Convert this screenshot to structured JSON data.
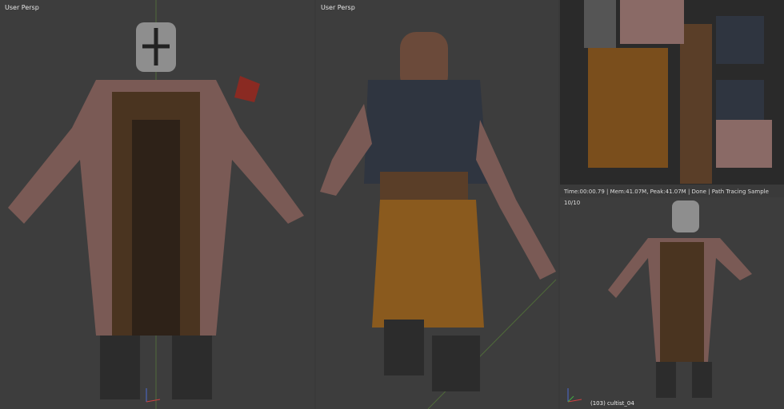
{
  "viewports": [
    {
      "label": "User Persp"
    },
    {
      "label": "User Persp"
    }
  ],
  "render": {
    "status": "Time:00:00.79 | Mem:41.07M, Peak:41.07M | Done | Path Tracing Sample 10/10",
    "object": "(103) cultist_04"
  },
  "colors": {
    "bg": "#3d3d3d",
    "apron": "#4a3420",
    "pants": "#8a5a1e",
    "vest": "#2f3540",
    "skin": "#8a6a66"
  }
}
